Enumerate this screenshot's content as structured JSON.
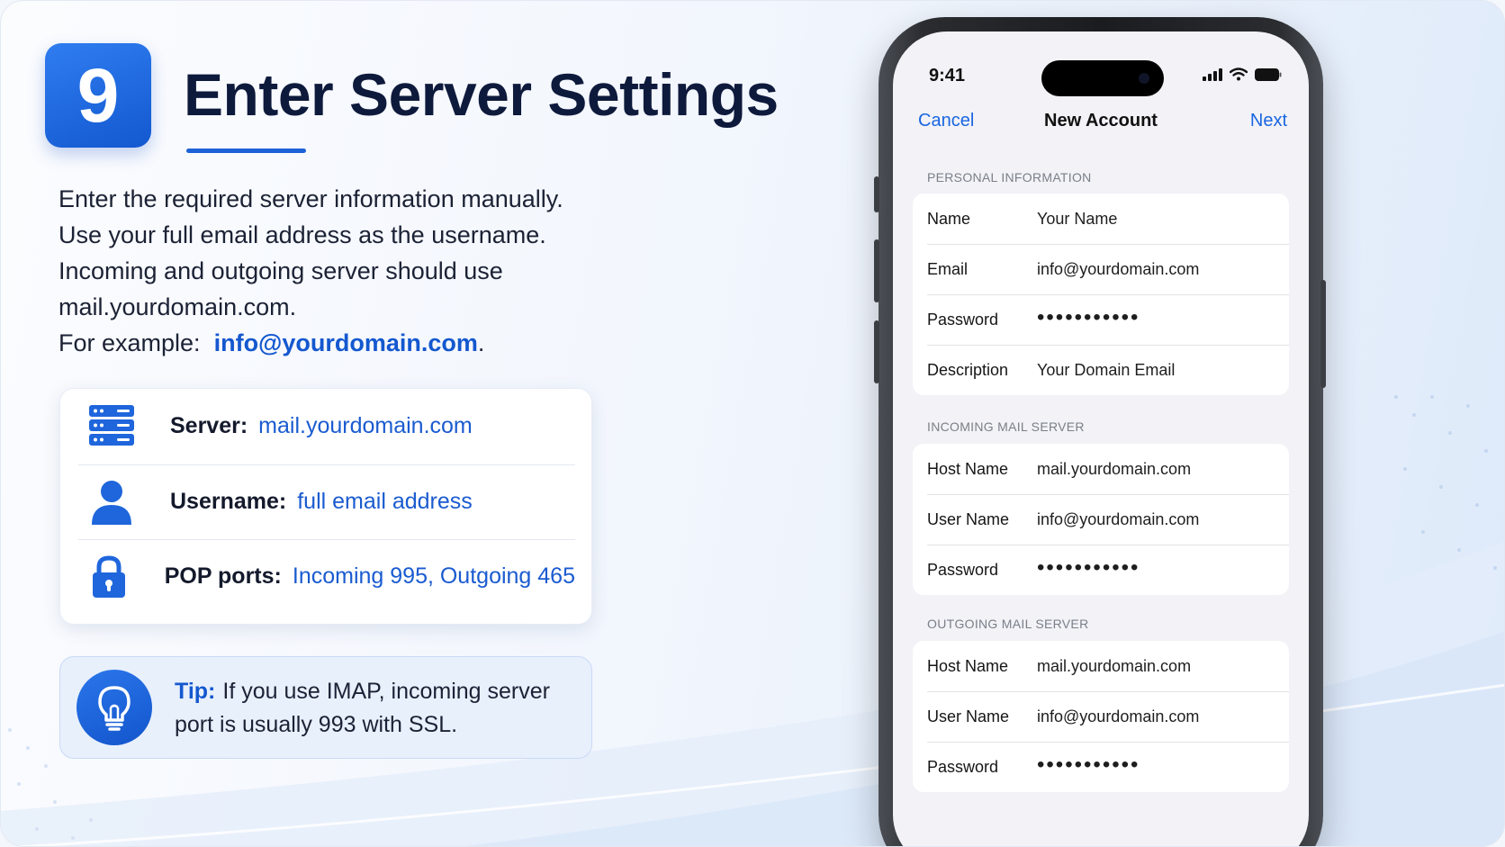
{
  "step": {
    "number": "9",
    "title": "Enter Server Settings"
  },
  "intro": {
    "line1": "Enter the required server information manually.",
    "line2": "Use your full email address as the username.",
    "line3": "Incoming and outgoing server should use",
    "line4": "mail.yourdomain.com.",
    "line5_prefix": "For example:",
    "line5_link": "info@yourdomain.com",
    "line5_suffix": "."
  },
  "info_card": {
    "server_label": "Server:",
    "server_value": "mail.yourdomain.com",
    "username_label": "Username:",
    "username_value": "full email address",
    "ports_label": "POP ports:",
    "ports_value": "Incoming 995, Outgoing 465"
  },
  "tip": {
    "label": "Tip:",
    "text": "If you use IMAP, incoming server port is usually 993 with SSL."
  },
  "phone": {
    "time": "9:41",
    "nav": {
      "cancel": "Cancel",
      "title": "New Account",
      "next": "Next"
    },
    "personal": {
      "header": "PERSONAL INFORMATION",
      "rows": [
        {
          "label": "Name",
          "value": "Your Name"
        },
        {
          "label": "Email",
          "value": "info@yourdomain.com"
        },
        {
          "label": "Password",
          "value": "•••••••••••"
        },
        {
          "label": "Description",
          "value": "Your Domain Email"
        }
      ]
    },
    "incoming": {
      "header": "INCOMING MAIL SERVER",
      "rows": [
        {
          "label": "Host Name",
          "value": "mail.yourdomain.com"
        },
        {
          "label": "User Name",
          "value": "info@yourdomain.com"
        },
        {
          "label": "Password",
          "value": "•••••••••••"
        }
      ]
    },
    "outgoing": {
      "header": "OUTGOING MAIL SERVER",
      "rows": [
        {
          "label": "Host Name",
          "value": "mail.yourdomain.com"
        },
        {
          "label": "User Name",
          "value": "info@yourdomain.com"
        },
        {
          "label": "Password",
          "value": "•••••••••••"
        }
      ]
    }
  },
  "colors": {
    "accent": "#1458cf",
    "title": "#0e1a3c",
    "ios_blue": "#1a66e0"
  },
  "icons": {
    "server": "server-icon",
    "user": "user-icon",
    "lock": "lock-icon",
    "tip": "lightbulb-icon"
  }
}
